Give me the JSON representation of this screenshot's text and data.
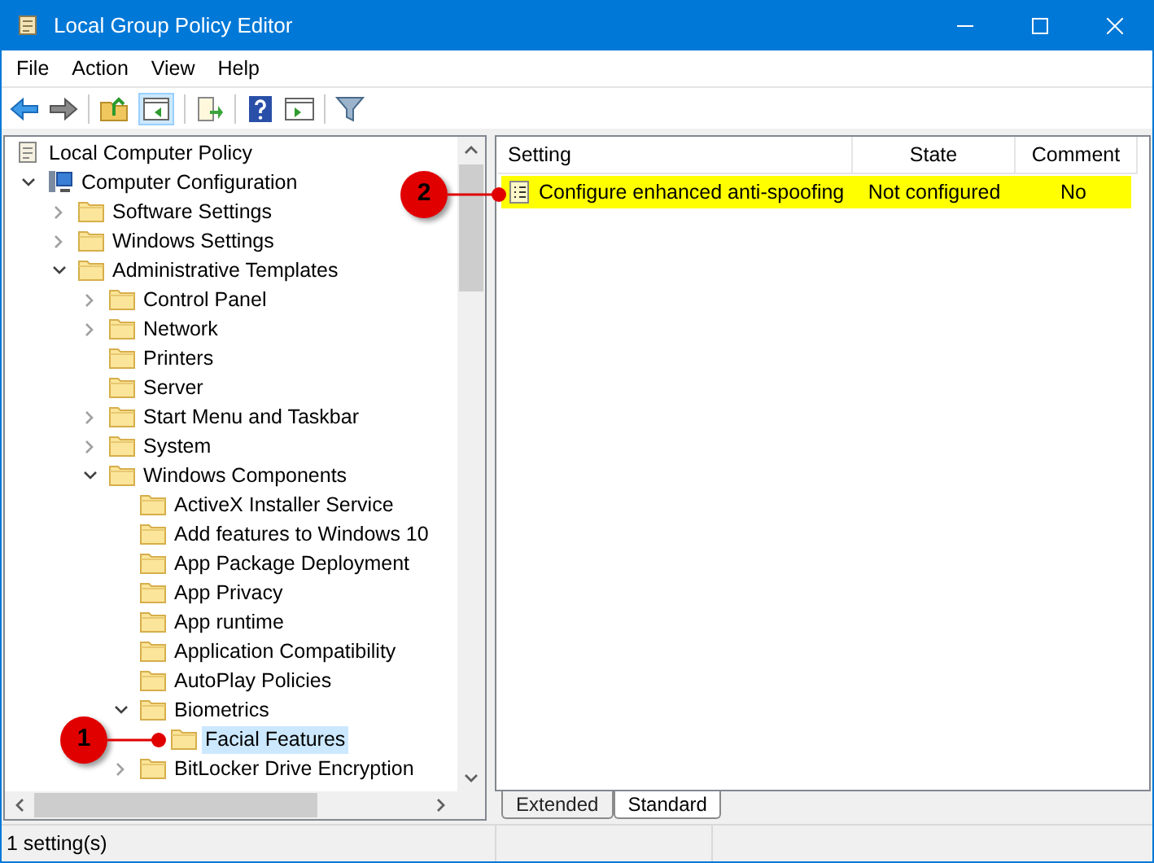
{
  "window": {
    "title": "Local Group Policy Editor"
  },
  "menu": [
    "File",
    "Action",
    "View",
    "Help"
  ],
  "tree": [
    {
      "label": "Local Computer Policy",
      "kind": "policy",
      "selected": false,
      "children": [
        {
          "label": "Computer Configuration",
          "kind": "computer",
          "expanded": true,
          "selected": false,
          "children": [
            {
              "label": "Software Settings",
              "expanded": false,
              "selected": false
            },
            {
              "label": "Windows Settings",
              "expanded": false,
              "selected": false
            },
            {
              "label": "Administrative Templates",
              "expanded": true,
              "selected": false,
              "children": [
                {
                  "label": "Control Panel",
                  "expanded": false,
                  "selected": false
                },
                {
                  "label": "Network",
                  "expanded": false,
                  "selected": false
                },
                {
                  "label": "Printers",
                  "selected": false
                },
                {
                  "label": "Server",
                  "selected": false
                },
                {
                  "label": "Start Menu and Taskbar",
                  "expanded": false,
                  "selected": false
                },
                {
                  "label": "System",
                  "expanded": false,
                  "selected": false
                },
                {
                  "label": "Windows Components",
                  "expanded": true,
                  "selected": false,
                  "children": [
                    {
                      "label": "ActiveX Installer Service",
                      "selected": false
                    },
                    {
                      "label": "Add features to Windows 10",
                      "selected": false
                    },
                    {
                      "label": "App Package Deployment",
                      "selected": false
                    },
                    {
                      "label": "App Privacy",
                      "selected": false
                    },
                    {
                      "label": "App runtime",
                      "selected": false
                    },
                    {
                      "label": "Application Compatibility",
                      "selected": false
                    },
                    {
                      "label": "AutoPlay Policies",
                      "selected": false
                    },
                    {
                      "label": "Biometrics",
                      "expanded": true,
                      "selected": false,
                      "children": [
                        {
                          "label": "Facial Features",
                          "selected": true
                        }
                      ]
                    },
                    {
                      "label": "BitLocker Drive Encryption",
                      "expanded": false,
                      "selected": false
                    }
                  ]
                }
              ]
            }
          ]
        }
      ]
    }
  ],
  "table": {
    "columns": [
      "Setting",
      "State",
      "Comment"
    ],
    "rows": [
      {
        "setting": "Configure enhanced anti-spoofing",
        "state": "Not configured",
        "comment": "No",
        "highlighted": true
      }
    ]
  },
  "tabs": [
    {
      "label": "Extended",
      "selected": false
    },
    {
      "label": "Standard",
      "selected": true
    }
  ],
  "callouts": [
    {
      "number": "1"
    },
    {
      "number": "2"
    }
  ],
  "status_bar": "1 setting(s)"
}
